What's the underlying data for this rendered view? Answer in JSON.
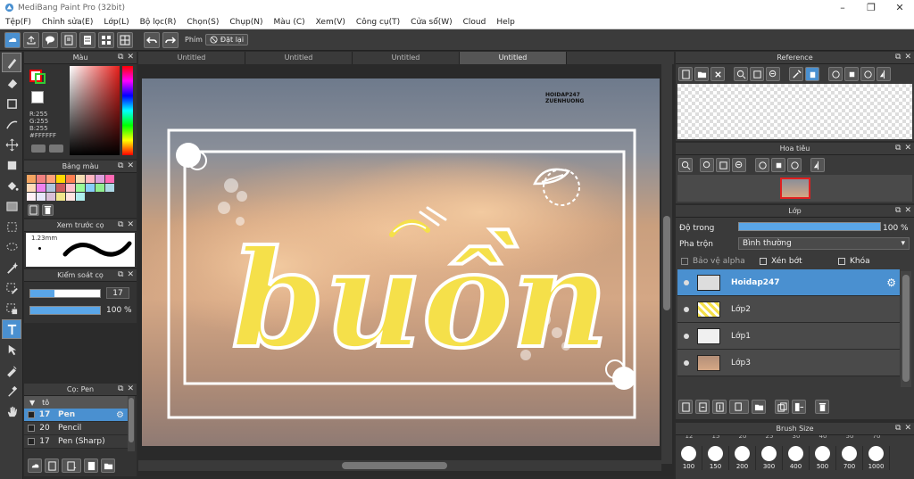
{
  "app": {
    "title": "MediBang Paint Pro (32bit)"
  },
  "menu": [
    "Tệp(F)",
    "Chỉnh sửa(E)",
    "Lớp(L)",
    "Bộ lọc(R)",
    "Chọn(S)",
    "Chụp(N)",
    "Màu (C)",
    "Xem(V)",
    "Công cụ(T)",
    "Cửa sổ(W)",
    "Cloud",
    "Help"
  ],
  "toolbar": {
    "hotkey_label": "Phím",
    "reset_label": "Đặt lại"
  },
  "color_panel": {
    "title": "Màu",
    "r": "R:255",
    "g": "G:255",
    "b": "B:255",
    "hex": "#FFFFFF"
  },
  "palette_panel": {
    "title": "Bảng màu",
    "swatches": [
      "#f4a460",
      "#f08080",
      "#ffa07a",
      "#ffd700",
      "#ff7f50",
      "#f5deb3",
      "#ffb6c1",
      "#dda0dd",
      "#ff69b4",
      "#ffdab9",
      "#ee82ee",
      "#b0c4de",
      "#cd5c5c",
      "#ffc0cb",
      "#98fb98",
      "#87cefa",
      "#90ee90",
      "#add8e6",
      "#fff0f5",
      "#e6e6fa",
      "#d8bfd8",
      "#f0e68c",
      "#ffe4e1",
      "#afeeee"
    ]
  },
  "brush_preview_panel": {
    "title": "Xem trước cọ",
    "size_label": "1.23mm"
  },
  "brush_control_panel": {
    "title": "Kiểm soát cọ",
    "size_value": "17",
    "opacity_value": "100 %"
  },
  "brush_panel": {
    "title": "Cọ: Pen",
    "group": "tô",
    "items": [
      {
        "size": "17",
        "name": "Pen",
        "selected": true
      },
      {
        "size": "20",
        "name": "Pencil",
        "selected": false
      },
      {
        "size": "17",
        "name": "Pen (Sharp)",
        "selected": false
      }
    ]
  },
  "tabs": [
    "Untitled",
    "Untitled",
    "Untitled",
    "Untitled"
  ],
  "canvas": {
    "watermark_line1": "HOIDAP247",
    "watermark_line2": "ZUENHUONG",
    "artwork_text": "buồn"
  },
  "reference_panel": {
    "title": "Reference"
  },
  "navigator_panel": {
    "title": "Hoa tiêu"
  },
  "layer_panel": {
    "title": "Lớp",
    "opacity_label": "Độ trong",
    "opacity_value": "100 %",
    "opacity_level": 1.0,
    "blend_label": "Pha trộn",
    "blend_value": "Bình thường",
    "protect_alpha": "Bảo vệ alpha",
    "clipping": "Xén bớt",
    "lock": "Khóa",
    "layers": [
      {
        "name": "Hoidap247",
        "selected": true
      },
      {
        "name": "Lớp2",
        "selected": false
      },
      {
        "name": "Lớp1",
        "selected": false
      },
      {
        "name": "Lớp3",
        "selected": false
      }
    ]
  },
  "brush_size_panel": {
    "title": "Brush Size",
    "top_row": [
      "12",
      "15",
      "20",
      "25",
      "30",
      "40",
      "50",
      "70"
    ],
    "bottom_row": [
      "100",
      "150",
      "200",
      "300",
      "400",
      "500",
      "700",
      "1000"
    ]
  },
  "colors": {
    "accent": "#4a90d0",
    "panel": "#3a3a3a",
    "canvas_bg": "#2a2a2a",
    "text_yellow": "#f5e04a"
  }
}
